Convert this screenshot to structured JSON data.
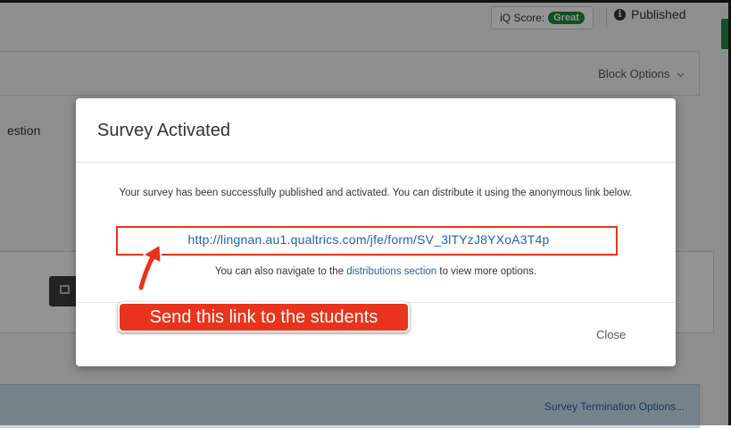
{
  "header": {
    "iq_score_label": "iQ Score:",
    "iq_score_value": "Great",
    "published_label": "Published"
  },
  "block": {
    "options_label": "Block Options",
    "question_partial": "estion"
  },
  "footer": {
    "termination_options": "Survey Termination Options..."
  },
  "modal": {
    "title": "Survey Activated",
    "message": "Your survey has been successfully published and activated. You can distribute it using the anonymous link below.",
    "anonymous_link": "http://lingnan.au1.qualtrics.com/jfe/form/SV_3lTYzJ8YXoA3T4p",
    "nav_prefix": "You can also navigate to the ",
    "nav_link": "distributions section",
    "nav_suffix": " to view more options.",
    "close_label": "Close"
  },
  "annotation": {
    "callout_text": "Send this link to the students"
  },
  "icons": {
    "info": "info-icon",
    "chevron": "chevron-down-icon",
    "copy": "copy-icon",
    "arrow": "annotation-arrow"
  },
  "colors": {
    "accent_green": "#1f8a3a",
    "link_blue": "#1d64a8",
    "annotation_red": "#e8341c"
  }
}
